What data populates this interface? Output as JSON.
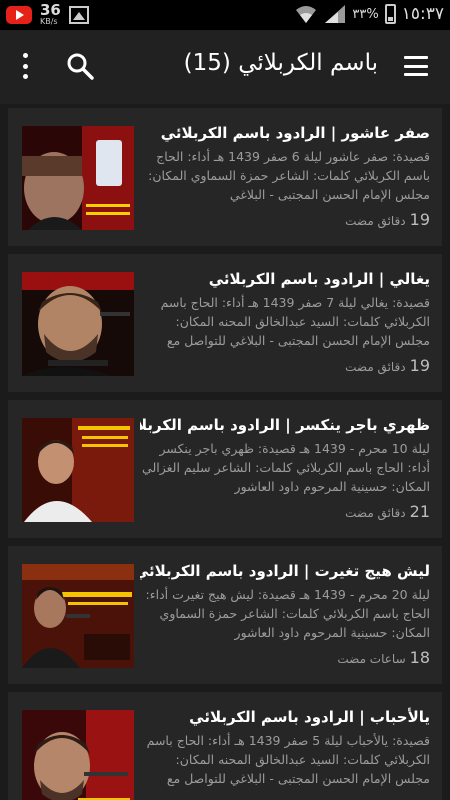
{
  "status_bar": {
    "speed_value": "36",
    "speed_unit": "KB/s",
    "battery_percent": "٣٣%",
    "time": "١٥:٣٧",
    "icons": [
      "youtube-icon",
      "gallery-icon",
      "wifi-icon",
      "signal-icon",
      "battery-icon"
    ]
  },
  "app_bar": {
    "title": "باسم الكربلائي (15)",
    "icons": [
      "menu-icon",
      "search-icon",
      "more-vert-icon"
    ]
  },
  "videos": [
    {
      "title": "صفر عاشور | الرادود باسم الكربلائي",
      "description": "قصيدة: صفر عاشور ليلة 6 صفر 1439 هـ أداء: الحاج باسم الكربلائي كلمات: الشاعر حمزة السماوي المكان: مجلس الإمام الحسن المجتبى - البلاغي",
      "duration_num": "19",
      "duration_unit": "دقائق مضت"
    },
    {
      "title": "يغالي | الرادود باسم الكربلائي",
      "description": "قصيدة: يغالي ليلة 7 صفر 1439 هـ أداء: الحاج باسم الكربلائي كلمات: السيد عبدالخالق المحنه المكان: مجلس الإمام الحسن المجتبى - البلاغي للتواصل مع",
      "duration_num": "19",
      "duration_unit": "دقائق مضت"
    },
    {
      "title": "ظهري باجر ينكسر | الرادود باسم الكربلائي",
      "description": "ليلة 10 محرم - 1439 هـ قصيدة: ظهري باجر ينكسر أداء: الحاج باسم الكربلائي كلمات: الشاعر سليم الغزالي المكان: حسينية المرحوم داود العاشور",
      "duration_num": "21",
      "duration_unit": "دقائق مضت"
    },
    {
      "title": "ليش هيج تغيرت | الرادود باسم الكربلائي",
      "description": "ليلة 20 محرم - 1439 هـ قصيدة: ليش هيج تغيرت أداء: الحاج باسم الكربلائي كلمات: الشاعر حمزة السماوي المكان: حسينية المرحوم داود العاشور",
      "duration_num": "18",
      "duration_unit": "ساعات مضت"
    },
    {
      "title": "يالأحباب | الرادود باسم الكربلائي",
      "description": "قصيدة: يالأحباب ليلة 5 صفر 1439 هـ أداء: الحاج باسم الكربلائي كلمات: السيد عبدالخالق المحنه المكان: مجلس الإمام الحسن المجتبى - البلاغي للتواصل مع",
      "duration_num": "",
      "duration_unit": ""
    }
  ]
}
